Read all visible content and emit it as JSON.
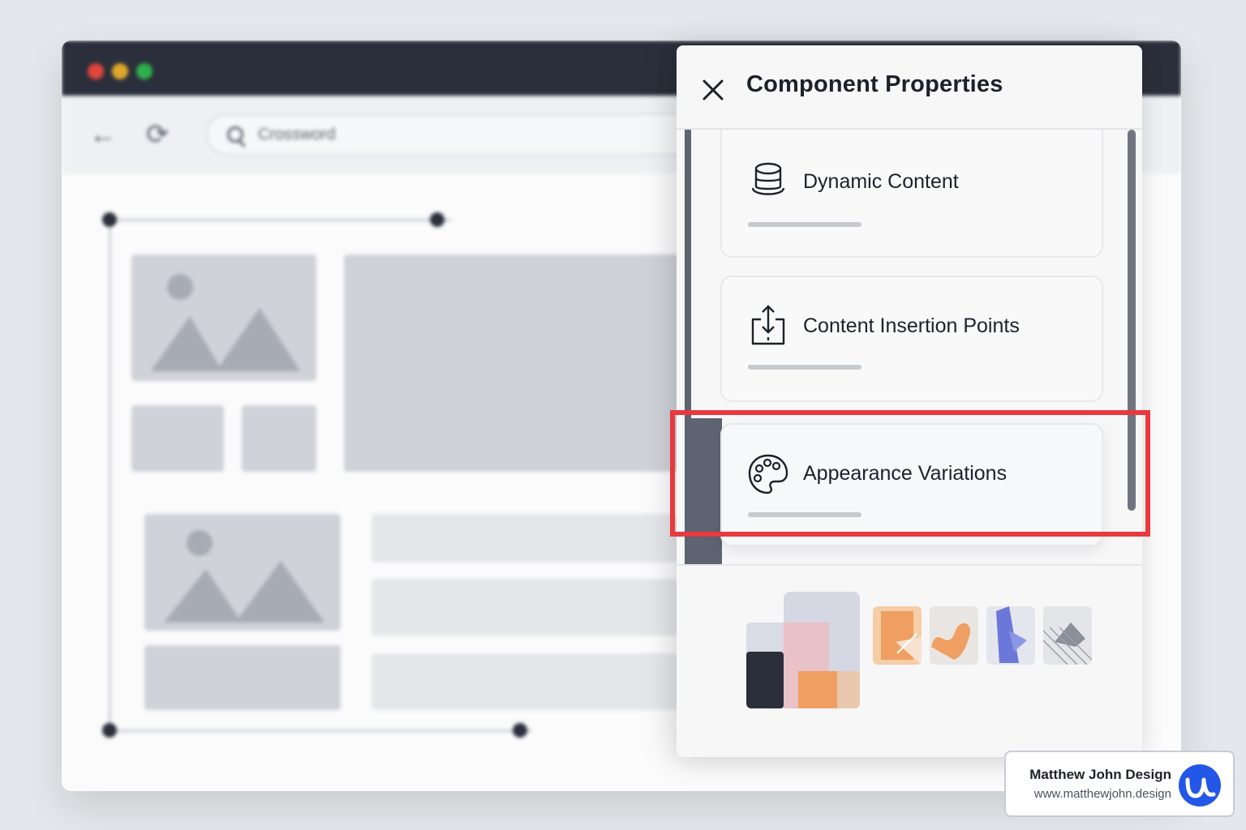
{
  "browser": {
    "window_controls": [
      "close",
      "minimize",
      "maximize"
    ],
    "back_icon": "arrow-left-icon",
    "reload_icon": "reload-icon",
    "address_bar": {
      "icon": "search-icon",
      "value": "Crossword"
    }
  },
  "panel": {
    "title": "Component Properties",
    "close_icon": "close-icon",
    "items": [
      {
        "label": "Dynamic Content",
        "icon": "database-icon",
        "selected": false
      },
      {
        "label": "Content Insertion Points",
        "icon": "insert-icon",
        "selected": false
      },
      {
        "label": "Appearance Variations",
        "icon": "palette-icon",
        "selected": true
      }
    ],
    "swatches": [
      "layered-preview",
      "orange-shape-1",
      "orange-shape-2",
      "blue-shape",
      "hatched-shape"
    ]
  },
  "colors": {
    "highlight": "#e8393f",
    "dark": "#2a2f3b",
    "accent_orange": "#ef9f61",
    "accent_blue": "#6b78d9"
  },
  "watermark": {
    "name": "Matthew John Design",
    "url": "www.matthewjohn.design"
  }
}
